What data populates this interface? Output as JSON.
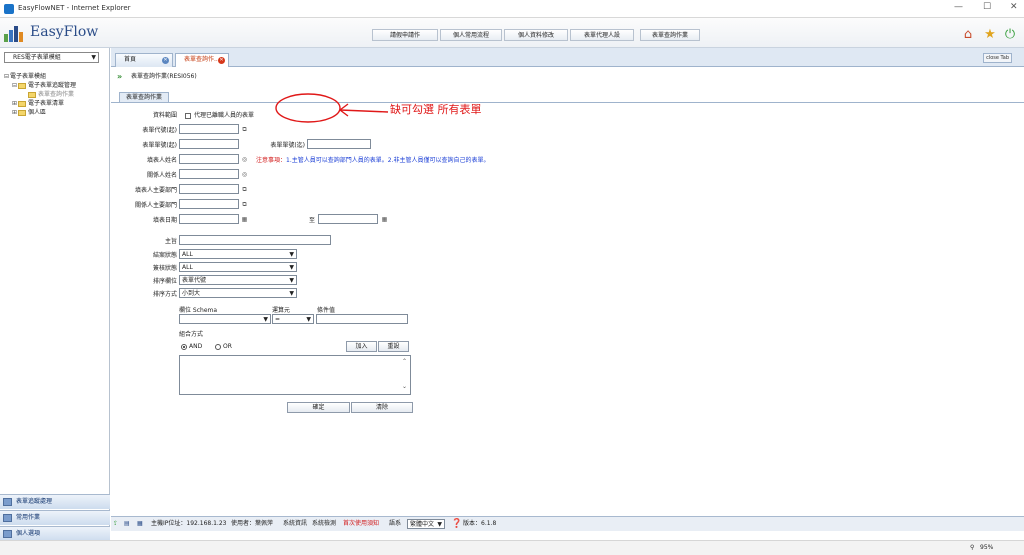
{
  "window": {
    "title": "EasyFlowNET - Internet Explorer",
    "minimize": "—",
    "maximize": "☐",
    "close": "✕"
  },
  "header": {
    "logo_text": "EasyFlow",
    "nav": [
      "請假申請作",
      "個人常用流程",
      "個人資料修改",
      "表單代理人設",
      "表單查詢作業"
    ]
  },
  "sidebar": {
    "module_select": "RES電子表單模組",
    "tree": {
      "root": "電子表單模組",
      "group1": "電子表單追蹤管理",
      "leaf1": "表單查詢作業",
      "group2": "電子表單清單",
      "group3": "個人區"
    },
    "accordion": [
      "表單追蹤處理",
      "常用作業",
      "個人選項"
    ]
  },
  "tabs": [
    {
      "label": "首頁"
    },
    {
      "label": "表單查詢作..."
    }
  ],
  "close_tab": "close Tab",
  "breadcrumb": "表單查詢作業(RESI056)",
  "form": {
    "tab_label": "表單查詢作業",
    "data_range_label": "資料範圍",
    "data_range_option": "代理已離職人員的表單",
    "form_code_label": "表單代號(起)",
    "form_no_from_label": "表單單號(起)",
    "form_no_to_label": "表單單號(迄)",
    "filler_name_label": "填表人姓名",
    "related_name_label": "關係人姓名",
    "filler_dept_label": "填表人主要部門",
    "related_dept_label": "關係人主要部門",
    "fill_date_label": "填表日期",
    "fill_date_to": "至",
    "subject_label": "主旨",
    "status_label": "結案狀態",
    "status_value": "ALL",
    "sign_status_label": "簽核狀態",
    "sign_status_value": "ALL",
    "sort_field_label": "排序欄位",
    "sort_field_value": "表單代號",
    "sort_order_label": "排序方式",
    "sort_order_value": "小到大",
    "schema_label": "欄位 Schema",
    "operator_label": "運算元",
    "operator_value": "=",
    "condition_label": "條件值",
    "combine_label": "組合方式",
    "and_label": "AND",
    "or_label": "OR",
    "add_button": "加入",
    "reset_button": "重設",
    "ok_button": "確定",
    "clear_button": "清除"
  },
  "notes": {
    "prefix": "注意事項：",
    "text": "1.主管人員可以查詢部門人員的表單。2.非主管人員僅可以查詢自己的表單。"
  },
  "annotation": "缺可勾選 所有表單",
  "statusbar": {
    "ip": "主機IP位址：192.168.1.23",
    "user": "使用者：葉佩萍",
    "sysinfo": "系統資訊",
    "syscheck": "系統檢測",
    "first_use": "首次使用須知",
    "lang_label": "語系",
    "lang_value": "繁體中文",
    "version": "版本：6.1.8"
  },
  "zoom": "95%",
  "colors": {
    "accent": "#2a4c88",
    "annotation": "#e01818",
    "notes": "#1b3fd6"
  }
}
